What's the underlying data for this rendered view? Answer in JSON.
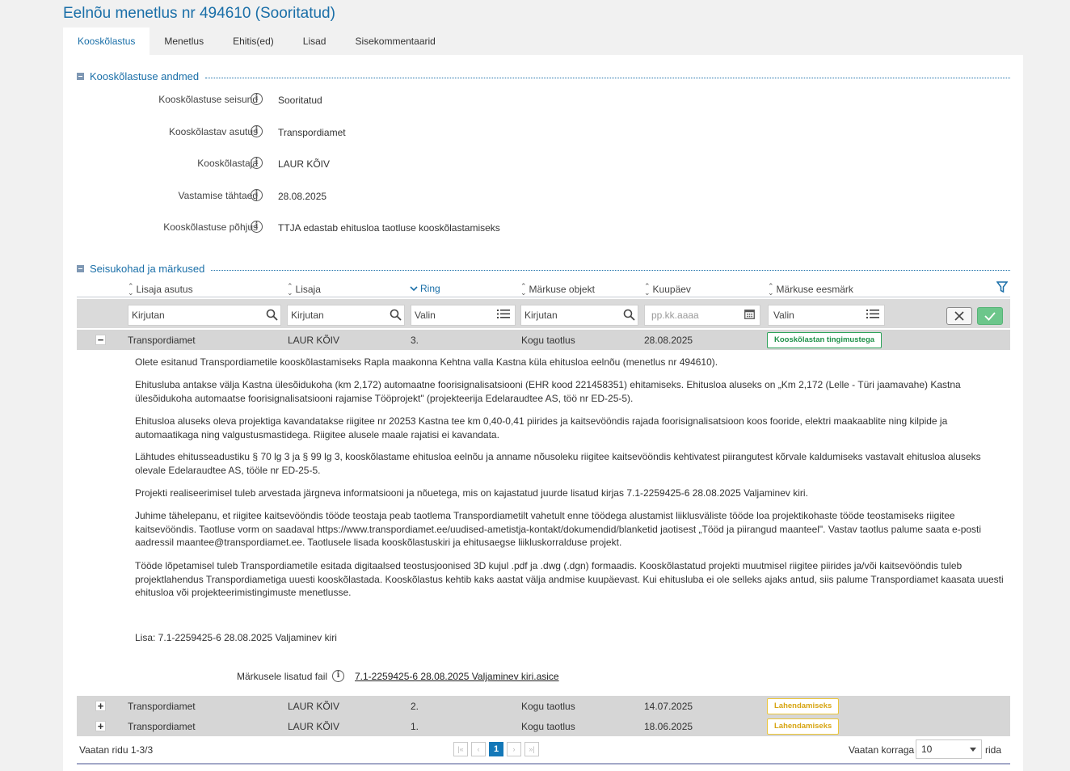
{
  "page": {
    "title": "Eelnõu menetlus nr 494610 (Sooritatud)"
  },
  "tabs": [
    {
      "label": "Kooskõlastus",
      "active": true
    },
    {
      "label": "Menetlus"
    },
    {
      "label": "Ehitis(ed)"
    },
    {
      "label": "Lisad"
    },
    {
      "label": "Sisekommentaarid"
    }
  ],
  "section_data": {
    "title": "Kooskõlastuse andmed",
    "fields": [
      {
        "label": "Kooskõlastuse seisund",
        "value": "Sooritatud"
      },
      {
        "label": "Kooskõlastav asutus",
        "value": "Transpordiamet"
      },
      {
        "label": "Kooskõlastaja",
        "value": "LAUR KÕIV"
      },
      {
        "label": "Vastamise tähtaeg",
        "value": "28.08.2025"
      },
      {
        "label": "Kooskõlastuse põhjus",
        "value": "TTJA edastab ehitusloa taotluse kooskõlastamiseks"
      }
    ]
  },
  "section_remarks": {
    "title": "Seisukohad ja märkused",
    "columns": [
      "Lisaja asutus",
      "Lisaja",
      "Ring",
      "Märkuse objekt",
      "Kuupäev",
      "Märkuse eesmärk"
    ],
    "filters": {
      "lisaja_asutus": "Kirjutan",
      "lisaja": "Kirjutan",
      "ring": "Valin",
      "objekt": "Kirjutan",
      "kuupaev": "pp.kk.aaaa",
      "eesmark": "Valin"
    },
    "rows": [
      {
        "expand": "−",
        "asutus": "Transpordiamet",
        "lisaja": "LAUR KÕIV",
        "ring": "3.",
        "objekt": "Kogu taotlus",
        "kuupaev": "28.08.2025",
        "eesmark": "Kooskõlastan tingimustega",
        "eesmark_color": "#1f9149"
      },
      {
        "expand": "+",
        "asutus": "Transpordiamet",
        "lisaja": "LAUR KÕIV",
        "ring": "2.",
        "objekt": "Kogu taotlus",
        "kuupaev": "14.07.2025",
        "eesmark": "Lahendamiseks",
        "eesmark_color": "#d7a513"
      },
      {
        "expand": "+",
        "asutus": "Transpordiamet",
        "lisaja": "LAUR KÕIV",
        "ring": "1.",
        "objekt": "Kogu taotlus",
        "kuupaev": "18.06.2025",
        "eesmark": "Lahendamiseks",
        "eesmark_color": "#d7a513"
      }
    ],
    "detail": {
      "paragraphs": [
        "Olete esitanud Transpordiametile kooskõlastamiseks Rapla maakonna Kehtna valla Kastna küla ehitusloa eelnõu (menetlus nr 494610).",
        "Ehitusluba antakse välja Kastna ülesõidukoha (km 2,172) automaatne foorisignalisatsiooni (EHR kood 221458351) ehitamiseks. Ehitusloa aluseks on „Km 2,172 (Lelle - Türi jaamavahe) Kastna ülesõidukoha automaatse foorisignalisatsiooni rajamise Tööprojekt\" (projekteerija Edelaraudtee AS, töö nr ED-25-5).",
        "Ehitusloa aluseks oleva projektiga kavandatakse riigitee nr 20253 Kastna tee km 0,40-0,41 piirides ja kaitsevööndis rajada foorisignalisatsioon koos fooride, elektri maakaablite ning kilpide ja automaatikaga ning valgustusmastidega. Riigitee alusele maale rajatisi ei kavandata.",
        "Lähtudes ehitusseadustiku § 70 lg 3 ja § 99 lg 3, kooskõlastame ehitusloa eelnõu ja anname nõusoleku riigitee kaitsevööndis kehtivatest piirangutest kõrvale kaldumiseks vastavalt ehitusloa aluseks olevale Edelaraudtee AS, tööle nr ED-25-5.",
        "Projekti realiseerimisel tuleb arvestada järgneva informatsiooni ja nõuetega, mis on kajastatud juurde lisatud kirjas 7.1-2259425-6 28.08.2025 Valjaminev kiri.",
        "Juhime tähelepanu, et riigitee kaitsevööndis tööde teostaja peab taotlema Transpordiametilt vahetult enne töödega alustamist liiklusväliste tööde loa projektikohaste tööde teostamiseks riigitee kaitsevööndis. Taotluse vorm on saadaval https://www.transpordiamet.ee/uudised-ametistja-kontakt/dokumendid/blanketid jaotisest „Tööd ja piirangud maanteel\". Vastav taotlus palume saata e-posti aadressil maantee@transpordiamet.ee. Taotlusele lisada kooskõlastuskiri ja ehitusaegse liikluskorralduse projekt.",
        "Tööde lõpetamisel tuleb Transpordiametile esitada digitaalsed teostusjoonised 3D kujul .pdf ja .dwg (.dgn) formaadis. Kooskõlastatud projekti muutmisel riigitee piirides ja/või kaitsevööndis tuleb projektlahendus Transpordiametiga uuesti kooskõlastada. Kooskõlastus kehtib kaks aastat välja andmise kuupäevast. Kui ehitusluba ei ole selleks ajaks antud, siis palume Transpordiamet kaasata uuesti ehitusloa või projekteerimistingimuste menetlusse.",
        "Lisa: 7.1-2259425-6 28.08.2025 Valjaminev kiri"
      ],
      "file_label": "Märkusele lisatud fail",
      "file_link": "7.1-2259425-6 28.08.2025 Valjaminev kiri.asice"
    },
    "footer": {
      "count": "Vaatan ridu 1-3/3",
      "pager": {
        "first": "|«",
        "prev": "‹",
        "current": "1",
        "next": "›",
        "last": "»|"
      },
      "per_page_label": "Vaatan korraga",
      "per_page_value": "10",
      "per_page_suffix": "rida"
    }
  },
  "colors": {
    "accent": "#1a6fa8",
    "confirm_green": "#6cc68b",
    "pager_active": "#1478b8"
  },
  "icons": [
    "info-icon",
    "collapse-icon",
    "sort-icon",
    "chevron-down-icon",
    "filter-icon",
    "search-icon",
    "list-icon",
    "calendar-icon",
    "close-icon",
    "check-icon",
    "plus-icon",
    "minus-icon"
  ]
}
